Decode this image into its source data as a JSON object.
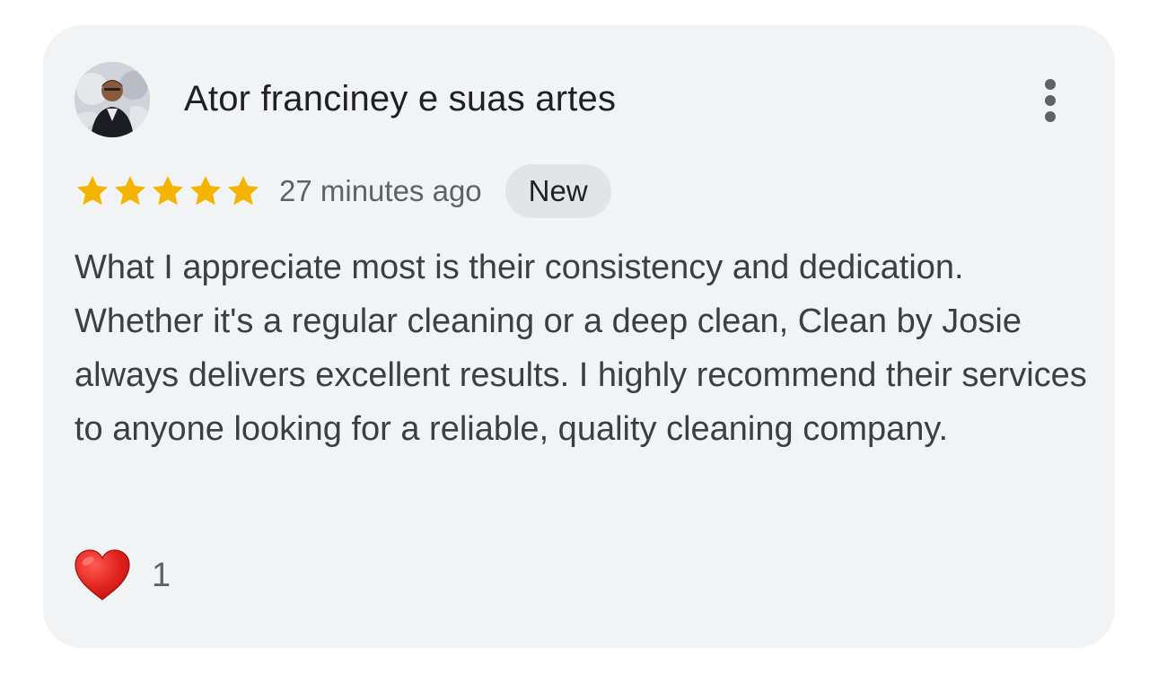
{
  "review": {
    "author_name": "Ator franciney e suas artes",
    "avatar_icon": "profile-photo",
    "more_options_icon": "more-vert-icon",
    "rating": 5,
    "rating_max": 5,
    "star_color": "#f4b400",
    "time_ago": "27 minutes ago",
    "badge": "New",
    "text": "What I appreciate most is their consistency and dedication. Whether it's a regular cleaning or a deep clean, Clean by Josie always delivers excellent results. I highly recommend their services to anyone looking for a reliable, quality cleaning company.",
    "reaction": {
      "icon": "heart-icon",
      "count": "1",
      "color": "#e0221f"
    }
  }
}
